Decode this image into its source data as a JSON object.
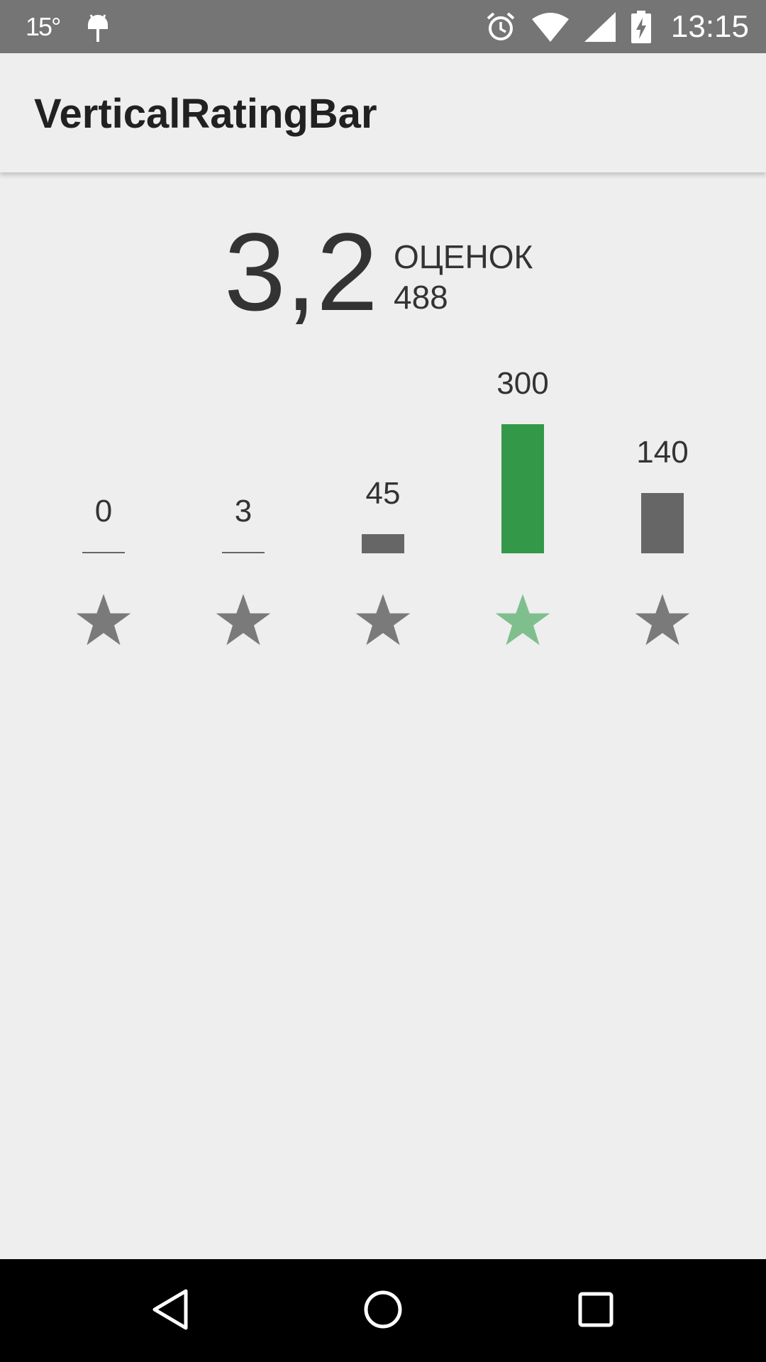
{
  "status_bar": {
    "temperature": "15°",
    "time": "13:15",
    "icons": [
      "android-icon",
      "alarm-icon",
      "wifi-icon",
      "signal-icon",
      "battery-charging-icon"
    ]
  },
  "app_bar": {
    "title": "VerticalRatingBar"
  },
  "summary": {
    "average": "3,2",
    "count_label": "ОЦЕНОК",
    "count_value": "488"
  },
  "colors": {
    "highlight_bar": "#339949",
    "highlight_star": "#7fbf8e",
    "default_bar": "#666666",
    "default_star": "#7a7a7a"
  },
  "chart_data": {
    "type": "bar",
    "categories": [
      "1",
      "2",
      "3",
      "4",
      "5"
    ],
    "values": [
      0,
      3,
      45,
      300,
      140
    ],
    "value_labels": [
      "0",
      "3",
      "45",
      "300",
      "140"
    ],
    "highlighted_index": 3,
    "xlabel": "",
    "ylabel": "",
    "ylim": [
      0,
      300
    ]
  },
  "nav_bar": {
    "icons": [
      "back-icon",
      "home-icon",
      "recents-icon"
    ]
  }
}
